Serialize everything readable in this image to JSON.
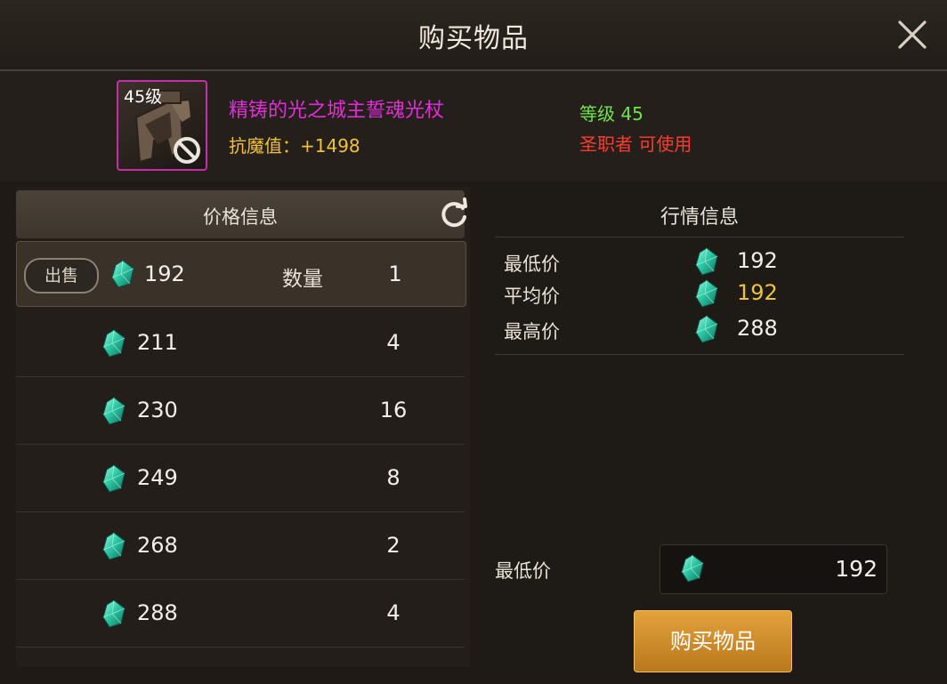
{
  "dialog": {
    "title": "购买物品"
  },
  "item": {
    "level_badge": "45级",
    "name": "精铸的光之城主誓魂光杖",
    "stat": "抗魔值：+1498",
    "grade": "等级 45",
    "usable_by": "圣职者 可使用"
  },
  "price_panel": {
    "title": "价格信息",
    "sell_label": "出售",
    "quantity_label": "数量",
    "selected": {
      "price": "192",
      "quantity": "1"
    },
    "rows": [
      {
        "price": "211",
        "quantity": "4"
      },
      {
        "price": "230",
        "quantity": "16"
      },
      {
        "price": "249",
        "quantity": "8"
      },
      {
        "price": "268",
        "quantity": "2"
      },
      {
        "price": "288",
        "quantity": "4"
      }
    ]
  },
  "market_panel": {
    "title": "行情信息",
    "lowest_label": "最低价",
    "lowest_value": "192",
    "average_label": "平均价",
    "average_value": "192",
    "highest_label": "最高价",
    "highest_value": "288"
  },
  "purchase": {
    "min_price_label": "最低价",
    "min_price_value": "192",
    "buy_button": "购买物品"
  },
  "colors": {
    "item_name": "#e22ed8",
    "stat": "#f0c23a",
    "grade": "#6fe54a",
    "class": "#ff3b30",
    "average_value": "#f0c23a",
    "gem": "#2ec9a6"
  }
}
